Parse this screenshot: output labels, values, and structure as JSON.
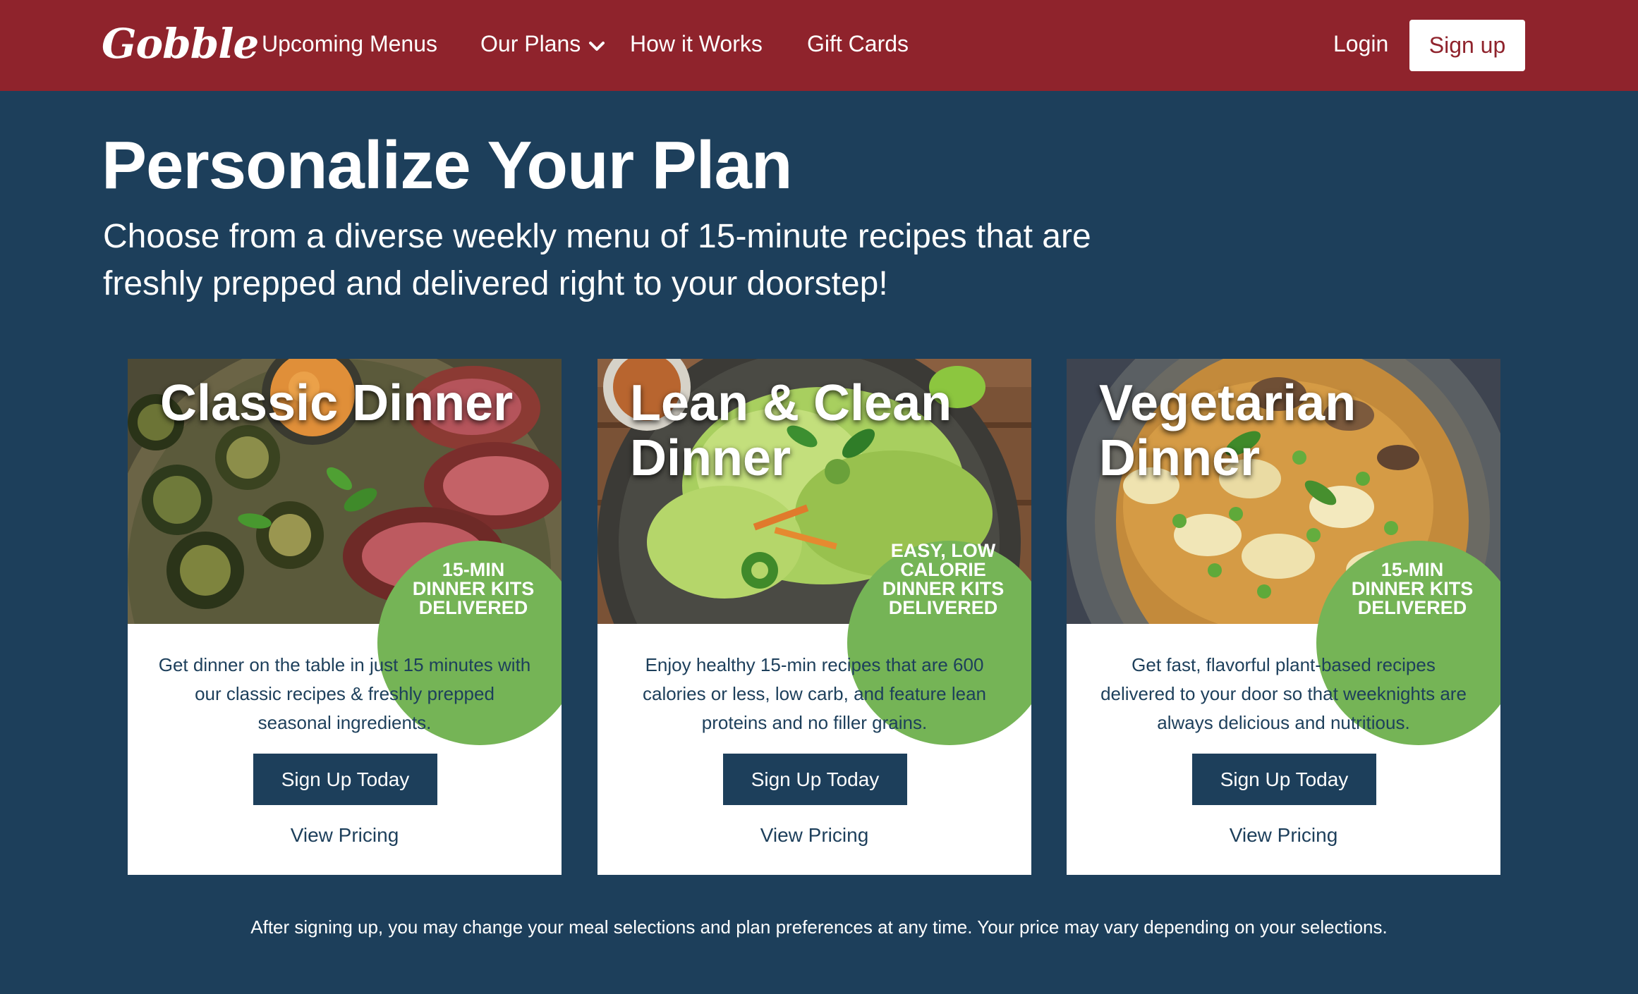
{
  "nav": {
    "logo": "Gobble",
    "links": [
      "Upcoming Menus",
      "Our Plans",
      "How it Works",
      "Gift Cards"
    ],
    "login": "Login",
    "signup": "Sign up"
  },
  "hero": {
    "title": "Personalize Your Plan",
    "subtitle": "Choose from a diverse weekly menu of 15-minute recipes that are freshly prepped and delivered right to your doorstep!"
  },
  "plans": [
    {
      "title": "Classic Dinner",
      "badge": [
        "15-MIN",
        "DINNER KITS",
        "DELIVERED"
      ],
      "description": "Get dinner on the table in just 15 minutes with our classic recipes & freshly prepped seasonal ingredients.",
      "cta": "Sign Up Today",
      "link": "View Pricing"
    },
    {
      "title": "Lean & Clean Dinner",
      "badge": [
        "EASY, LOW",
        "CALORIE",
        "DINNER KITS",
        "DELIVERED"
      ],
      "description": "Enjoy healthy 15-min recipes that are 600 calories or less, low carb, and feature lean proteins and no filler grains.",
      "cta": "Sign Up Today",
      "link": "View Pricing"
    },
    {
      "title": "Vegetarian Dinner",
      "badge": [
        "15-MIN",
        "DINNER KITS",
        "DELIVERED"
      ],
      "description": "Get fast, flavorful plant-based recipes delivered to your door so that weeknights are always delicious and nutritious.",
      "cta": "Sign Up Today",
      "link": "View Pricing"
    }
  ],
  "footnote": "After signing up, you may change your meal selections and plan preferences at any time. Your price may vary depending on your selections.",
  "colors": {
    "nav_bg": "#8f232c",
    "page_bg": "#1d3f5b",
    "badge_green": "#75b456"
  }
}
